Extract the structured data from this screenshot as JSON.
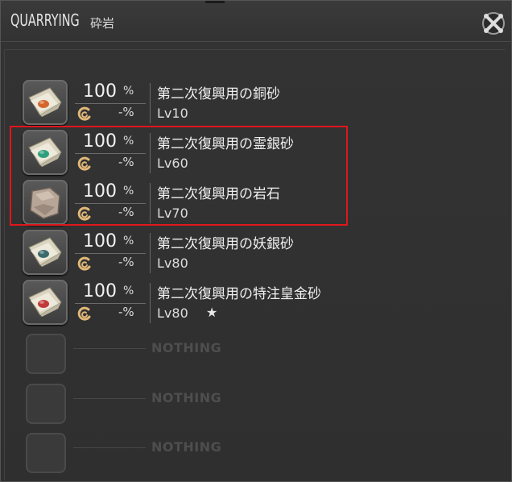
{
  "window": {
    "title": "QUARRYING",
    "subtitle": "砕岩",
    "close_icon": "close-gear-icon"
  },
  "items": [
    {
      "percent": "100",
      "percent_sign": "%",
      "hq_percent": "-%",
      "name": "第二次復興用の銅砂",
      "level": "Lv10",
      "star": "",
      "icon": "ore-sand-bundle-orange",
      "gem_color": "#d4662e"
    },
    {
      "percent": "100",
      "percent_sign": "%",
      "hq_percent": "-%",
      "name": "第二次復興用の霊銀砂",
      "level": "Lv60",
      "star": "",
      "icon": "ore-sand-bundle-teal",
      "gem_color": "#2fa07e"
    },
    {
      "percent": "100",
      "percent_sign": "%",
      "hq_percent": "-%",
      "name": "第二次復興用の岩石",
      "level": "Lv70",
      "star": "",
      "icon": "rock-icon",
      "gem_color": "#a08a78"
    },
    {
      "percent": "100",
      "percent_sign": "%",
      "hq_percent": "-%",
      "name": "第二次復興用の妖銀砂",
      "level": "Lv80",
      "star": "",
      "icon": "ore-sand-bundle-slate",
      "gem_color": "#3d6a6c"
    },
    {
      "percent": "100",
      "percent_sign": "%",
      "hq_percent": "-%",
      "name": "第二次復興用の特注皇金砂",
      "level": "Lv80",
      "star": "★",
      "icon": "ore-sand-bundle-red",
      "gem_color": "#c23a3a"
    }
  ],
  "empty_slots": [
    {
      "label": "NOTHING"
    },
    {
      "label": "NOTHING"
    },
    {
      "label": "NOTHING"
    }
  ],
  "colors": {
    "highlight_border": "#e0161c",
    "hq_icon": "#e0b878"
  }
}
